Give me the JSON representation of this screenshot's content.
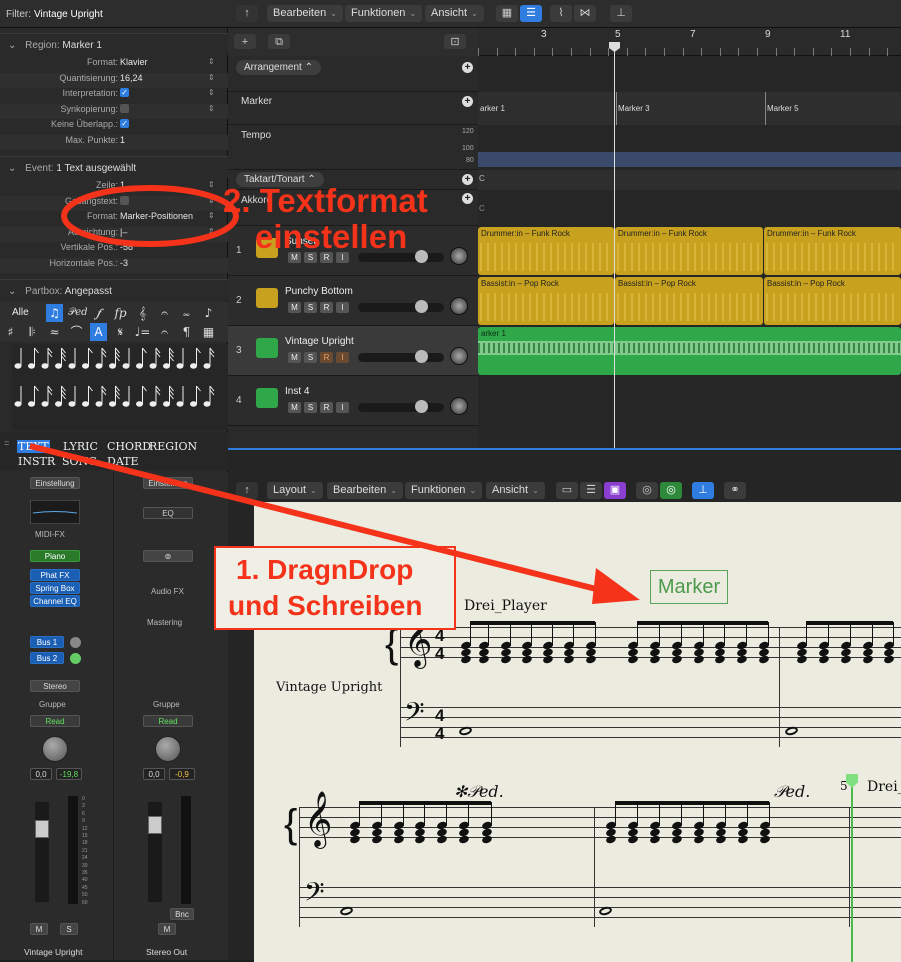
{
  "inspector": {
    "filter_label": "Filter:",
    "filter_value": "Vintage Upright",
    "region_label": "Region:",
    "region_value": "Marker 1",
    "region_rows": [
      {
        "label": "Format:",
        "value": "Klavier"
      },
      {
        "label": "Quantisierung:",
        "value": "16,24"
      },
      {
        "label": "Interpretation:",
        "value": "✓"
      },
      {
        "label": "Synkopierung:",
        "value": ""
      },
      {
        "label": "Keine Überlapp.:",
        "value": "✓"
      },
      {
        "label": "Max. Punkte:",
        "value": "1"
      }
    ],
    "event_label": "Event:",
    "event_value": "1 Text ausgewählt",
    "event_rows": [
      {
        "label": "Zeile:",
        "value": "1"
      },
      {
        "label": "Gesangstext:",
        "value": ""
      },
      {
        "label": "Format:",
        "value": "Marker-Positionen"
      },
      {
        "label": "Ausrichtung:",
        "value": "|–"
      },
      {
        "label": "Vertikale Pos.:",
        "value": "-58"
      },
      {
        "label": "Horizontale Pos.:",
        "value": "-3"
      }
    ],
    "partbox_label": "Partbox:",
    "partbox_value": "Angepasst",
    "partbox_all": "Alle",
    "text_options": [
      "TEXT",
      "LYRIC",
      "CHORD",
      "REGION",
      "INSTR",
      "SONG",
      "DATE"
    ]
  },
  "mixer": {
    "ch1": {
      "setting": "Einstellung",
      "midi_fx": "MIDI-FX",
      "instrument": "Piano",
      "plugins": [
        "Phat FX",
        "Spring Box",
        "Channel EQ"
      ],
      "sends": [
        "Bus 1",
        "Bus 2"
      ],
      "output": "Stereo",
      "group": "Gruppe",
      "automation": "Read",
      "pan_val": "0,0",
      "level": "-19,8",
      "name": "Vintage Upright"
    },
    "ch2": {
      "setting": "Einstellung",
      "eq": "EQ",
      "audio_fx": "Audio FX",
      "mastering": "Mastering",
      "group": "Gruppe",
      "automation": "Read",
      "pan_val": "0,0",
      "level": "-0,9",
      "bnc": "Bnc",
      "name": "Stereo Out"
    },
    "meter_scale": [
      "0",
      "3",
      "6",
      "9",
      "12",
      "15",
      "18",
      "21",
      "24",
      "30",
      "35",
      "40",
      "45",
      "50",
      "60"
    ]
  },
  "main_toolbar": {
    "edit": "Bearbeiten",
    "functions": "Funktionen",
    "view": "Ansicht"
  },
  "tracks_header": {
    "arrangement": "Arrangement",
    "marker": "Marker",
    "tempo": "Tempo",
    "tempo_scale": [
      "120",
      "100",
      "80"
    ],
    "signature": "Taktart/Tonart",
    "chord": "Akkord"
  },
  "tracks": [
    {
      "num": "1",
      "name": "Sunset",
      "color": "#c8a21e",
      "icon": "drum-icon"
    },
    {
      "num": "2",
      "name": "Punchy Bottom",
      "color": "#c8a21e",
      "icon": "bass-guitar-icon"
    },
    {
      "num": "3",
      "name": "Vintage Upright",
      "color": "#2fa84a",
      "icon": "piano-icon"
    },
    {
      "num": "4",
      "name": "Inst 4",
      "color": "#2fa84a",
      "icon": "synth-icon"
    }
  ],
  "msri": [
    "M",
    "S",
    "R",
    "I"
  ],
  "ruler": [
    "3",
    "5",
    "7",
    "9",
    "11"
  ],
  "markers": [
    "arker 1",
    "Marker 3",
    "Marker 5"
  ],
  "signature_key": "C",
  "regions": {
    "drummer": [
      "Drummer:in – Funk Rock",
      "Drummer:in – Funk Rock",
      "Drummer:in – Funk Rock"
    ],
    "bass": [
      "Bassist:in – Pop Rock",
      "Bassist:in – Pop Rock",
      "Bassist:in – Pop Rock"
    ],
    "piano": "arker 1"
  },
  "score_toolbar": {
    "layout": "Layout",
    "edit": "Bearbeiten",
    "functions": "Funktionen",
    "view": "Ansicht"
  },
  "score": {
    "marker_text": "Marker",
    "player_text": "Drei_Player",
    "instrument_name": "Vintage Upright",
    "time_sig_top": "4",
    "time_sig_bottom": "4",
    "bar_number": "5",
    "player_text_2": "Drei_"
  },
  "annotations": {
    "step1_line1": "1. DragnDrop",
    "step1_line2": "und Schreiben",
    "step2_line1": "2. Textformat",
    "step2_line2": "einstellen",
    "color": "#f5321a"
  }
}
